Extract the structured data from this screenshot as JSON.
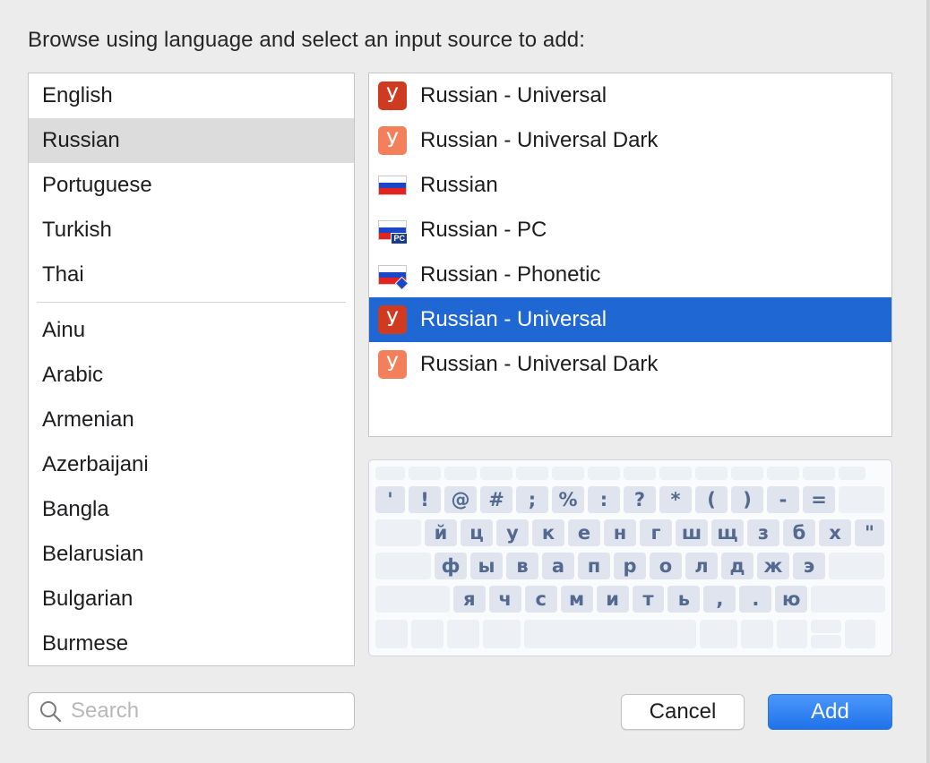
{
  "prompt": "Browse using language and select an input source to add:",
  "languages": {
    "top": [
      "English",
      "Russian",
      "Portuguese",
      "Turkish",
      "Thai"
    ],
    "selected": "Russian",
    "all": [
      "Ainu",
      "Arabic",
      "Armenian",
      "Azerbaijani",
      "Bangla",
      "Belarusian",
      "Bulgarian",
      "Burmese"
    ]
  },
  "sources": [
    {
      "label": "Russian - Universal",
      "icon": "yandex-u-dark-icon",
      "glyph": "У",
      "selected": false
    },
    {
      "label": "Russian - Universal Dark",
      "icon": "yandex-u-light-icon",
      "glyph": "У",
      "selected": false
    },
    {
      "label": "Russian",
      "icon": "russian-flag-icon",
      "selected": false
    },
    {
      "label": "Russian - PC",
      "icon": "russian-flag-pc-icon",
      "badge": "PC",
      "selected": false
    },
    {
      "label": "Russian - Phonetic",
      "icon": "russian-flag-phonetic-icon",
      "selected": false
    },
    {
      "label": "Russian - Universal",
      "icon": "yandex-u-dark-icon",
      "glyph": "У",
      "selected": true
    },
    {
      "label": "Russian - Universal Dark",
      "icon": "yandex-u-light-icon",
      "glyph": "У",
      "selected": false
    }
  ],
  "keyboard": {
    "row1": [
      "'",
      "!",
      "@",
      "#",
      ";",
      "%",
      ":",
      "?",
      "*",
      "(",
      ")",
      "-",
      "="
    ],
    "row2": [
      "й",
      "ц",
      "у",
      "к",
      "е",
      "н",
      "г",
      "ш",
      "щ",
      "з",
      "б",
      "х",
      "\""
    ],
    "row3": [
      "ф",
      "ы",
      "в",
      "а",
      "п",
      "р",
      "о",
      "л",
      "д",
      "ж",
      "э"
    ],
    "row4": [
      "я",
      "ч",
      "с",
      "м",
      "и",
      "т",
      "ь",
      ",",
      ".",
      "ю"
    ]
  },
  "search": {
    "placeholder": "Search",
    "value": ""
  },
  "buttons": {
    "cancel": "Cancel",
    "add": "Add"
  },
  "colors": {
    "selection_blue": "#1f68d4",
    "list_selection_gray": "#dcdcdc",
    "key_text": "#54698f"
  }
}
